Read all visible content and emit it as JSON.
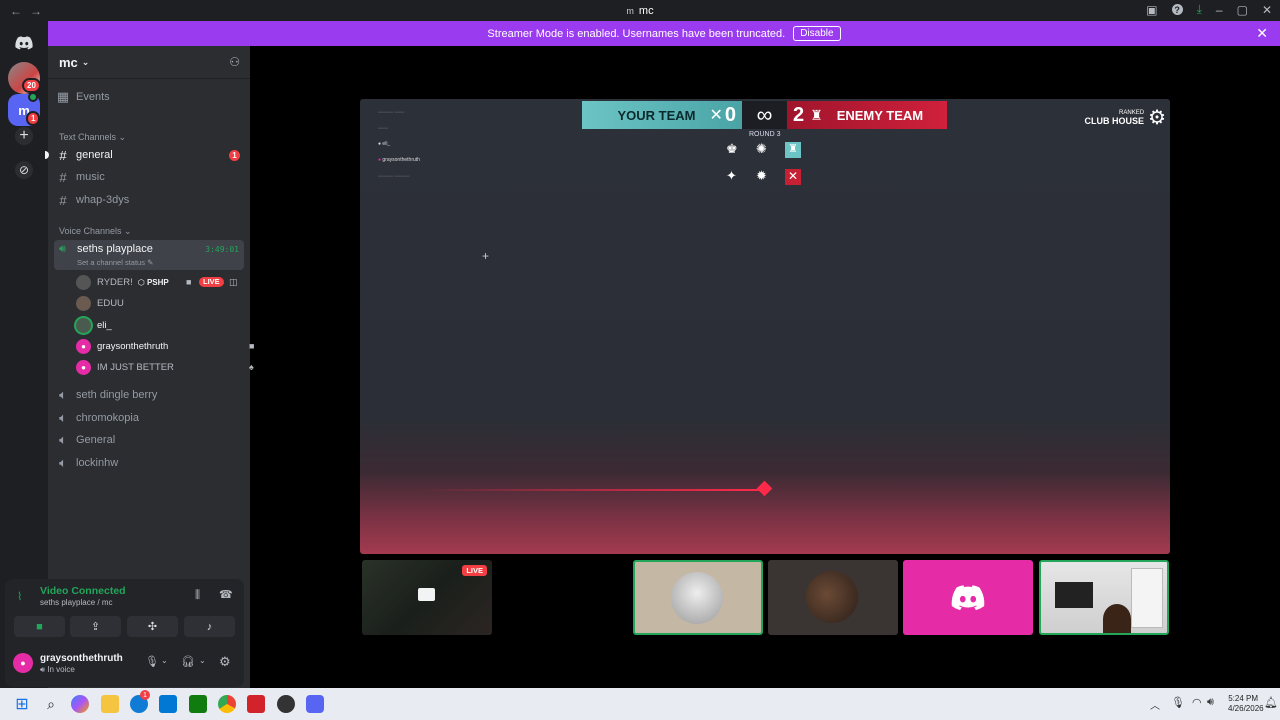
{
  "window": {
    "title_icon": "m",
    "title": "mc",
    "back": "←",
    "forward": "→"
  },
  "banner": {
    "text": "Streamer Mode is enabled. Usernames have been truncated.",
    "button": "Disable"
  },
  "rail": {
    "badge_1": "20",
    "badge_2": "1",
    "server_letter": "m"
  },
  "server": {
    "name": "mc"
  },
  "sidebar": {
    "events": "Events",
    "text_category": "Text Channels",
    "text_channels": [
      "general",
      "music",
      "whap-3dys"
    ],
    "general_badge": "1",
    "voice_category": "Voice Channels",
    "active_voice": {
      "name": "seths playplace",
      "timer": "3:49:01",
      "status": "Set a channel status"
    },
    "voice_users": [
      {
        "name": "RYDER!",
        "tag": "PSHP",
        "live": "LIVE"
      },
      {
        "name": "EDUU"
      },
      {
        "name": "eli_"
      },
      {
        "name": "graysonthethruth"
      },
      {
        "name": "IM JUST BETTER"
      }
    ],
    "voice_channels": [
      "seth dingle berry",
      "chromokopia",
      "General",
      "lockinhw"
    ]
  },
  "voice_panel": {
    "status": "Video Connected",
    "location": "seths playplace / mc"
  },
  "user": {
    "name": "graysonthethruth",
    "status": "In voice"
  },
  "game": {
    "your_team": "YOUR TEAM",
    "your_score": "0",
    "center": "∞",
    "enemy_score": "2",
    "enemy_team": "ENEMY TEAM",
    "round": "ROUND 3",
    "mode": "RANKED",
    "map": "CLUB HOUSE",
    "feed": [
      "eli_",
      "graysonthethruth"
    ]
  },
  "tiles": {
    "live": "LIVE"
  },
  "taskbar": {
    "time": "5:24 PM",
    "date": "4/26/2026",
    "badge": "1"
  },
  "colors": {
    "accent": "#9b3bf0",
    "green": "#23a55a",
    "red": "#f23f43",
    "discord_pink": "#e52ca6",
    "blurple": "#5865f2"
  }
}
